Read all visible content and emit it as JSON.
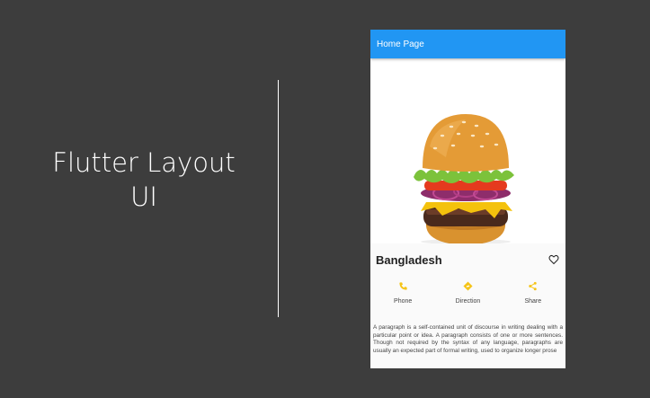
{
  "banner": {
    "line1": "Flutter Layout",
    "line2": "UI"
  },
  "app": {
    "appbar_title": "Home Page",
    "place_title": "Bangladesh",
    "hero_image": "burger-image",
    "favorite_icon": "heart-outline-icon",
    "accent_color": "#2196f3",
    "action_color": "#f5c418",
    "actions": [
      {
        "icon": "phone-icon",
        "label": "Phone"
      },
      {
        "icon": "direction-icon",
        "label": "Direction"
      },
      {
        "icon": "share-icon",
        "label": "Share"
      }
    ],
    "description": "A paragraph is a self-contained unit of discourse in writing dealing with a particular point or idea. A paragraph consists of one or more sentences. Though not required by the syntax of any language, paragraphs are usually an expected part of formal writing, used to organize longer prose"
  }
}
